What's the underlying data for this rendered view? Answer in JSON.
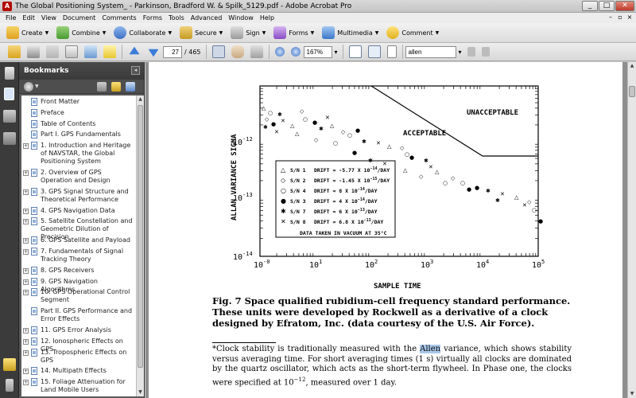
{
  "window": {
    "title": "The Global Positioning System_ - Parkinson, Bradford W. & Spilk_5129.pdf - Adobe Acrobat Pro",
    "controls": [
      "_",
      "□",
      "✕"
    ]
  },
  "menubar": {
    "items": [
      "File",
      "Edit",
      "View",
      "Document",
      "Comments",
      "Forms",
      "Tools",
      "Advanced",
      "Window",
      "Help"
    ]
  },
  "toolbar1": {
    "create": "Create",
    "combine": "Combine",
    "collaborate": "Collaborate",
    "secure": "Secure",
    "sign": "Sign",
    "forms": "Forms",
    "multimedia": "Multimedia",
    "comment": "Comment"
  },
  "toolbar2": {
    "page_current": "27",
    "page_total": "/ 465",
    "zoom": "167%",
    "search_value": "allen"
  },
  "bookmarks": {
    "title": "Bookmarks",
    "items": [
      {
        "label": "Front Matter",
        "expandable": false
      },
      {
        "label": "Preface",
        "expandable": false
      },
      {
        "label": "Table of Contents",
        "expandable": false
      },
      {
        "label": "Part I. GPS Fundamentals",
        "expandable": false
      },
      {
        "label": "1. Introduction and Heritage of NAVSTAR, the Global Positioning System",
        "expandable": true
      },
      {
        "label": "2. Overview of GPS Operation and Design",
        "expandable": true
      },
      {
        "label": "3. GPS Signal Structure and Theoretical Performance",
        "expandable": true
      },
      {
        "label": "4. GPS Navigation Data",
        "expandable": true
      },
      {
        "label": "5. Satellite Constellation and Geometric Dilution of Precision",
        "expandable": true
      },
      {
        "label": "6. GPS Satellite and Payload",
        "expandable": true
      },
      {
        "label": "7. Fundamentals of Signal Tracking Theory",
        "expandable": true
      },
      {
        "label": "8. GPS Receivers",
        "expandable": true
      },
      {
        "label": "9. GPS Navigation Algorithms",
        "expandable": true
      },
      {
        "label": "10. GPS Operational Control Segment",
        "expandable": true
      },
      {
        "label": "Part II. GPS Performance and Error Effects",
        "expandable": false
      },
      {
        "label": "11. GPS Error Analysis",
        "expandable": true
      },
      {
        "label": "12. Ionospheric Effects on GPS",
        "expandable": true
      },
      {
        "label": "13. Tropospheric Effects on GPS",
        "expandable": true
      },
      {
        "label": "14. Multipath Effects",
        "expandable": true
      },
      {
        "label": "15. Foliage Attenuation for Land Mobile Users",
        "expandable": true
      }
    ]
  },
  "figure": {
    "ylabel": "ALLAN VARIANCE SIGMA",
    "xlabel": "SAMPLE TIME",
    "unacceptable": "UNACCEPTABLE",
    "acceptable": "ACCEPTABLE",
    "x_ticks": [
      {
        "base": "10",
        "exp": "-0"
      },
      {
        "base": "10",
        "exp": "1"
      },
      {
        "base": "10",
        "exp": "2"
      },
      {
        "base": "10",
        "exp": "3"
      },
      {
        "base": "10",
        "exp": "4"
      },
      {
        "base": "10",
        "exp": "5"
      }
    ],
    "y_ticks": [
      {
        "base": "10",
        "exp": "-12"
      },
      {
        "base": "10",
        "exp": "-13"
      },
      {
        "base": "10",
        "exp": "-14"
      }
    ],
    "legend": [
      {
        "sym": "△",
        "sn": "S/N 1",
        "drift": "DRIFT = -5.77 X 10",
        "exp": "-14",
        "unit": "/DAY"
      },
      {
        "sym": "◇",
        "sn": "S/N 2",
        "drift": "DRIFT = -1.45 X 10",
        "exp": "-15",
        "unit": "/DAY"
      },
      {
        "sym": "○",
        "sn": "S/N 4",
        "drift": "DRIFT = 8 X 10",
        "exp": "-14",
        "unit": "/DAY"
      },
      {
        "sym": "●",
        "sn": "S/N 3",
        "drift": "DRIFT = 4 X 10",
        "exp": "-14",
        "unit": "/DAY"
      },
      {
        "sym": "✱",
        "sn": "S/N 7",
        "drift": "DRIFT = 6 X 10",
        "exp": "-13",
        "unit": "/DAY"
      },
      {
        "sym": "✕",
        "sn": "S/N 8",
        "drift": "DRIFT = 6.8 X 10",
        "exp": "-13",
        "unit": "/DAY"
      }
    ],
    "legend_note": "DATA TAKEN IN VACUUM AT 35°C"
  },
  "caption": {
    "text": "Fig. 7   Space qualified rubidium-cell frequency standard performance. These units were developed by Rockwell as a derivative of a clock designed by Efratom, Inc. (data courtesy of the U.S. Air Force)."
  },
  "footnote": {
    "part1": "*Clock stability is traditionally measured with the ",
    "highlight": "Allen",
    "part2": " variance, which shows stability versus averaging time. For short averaging times (1 s) virtually all clocks are dominated by the quartz oscillator, which acts as the short-term flywheel. In Phase one, the clocks were specified at 10",
    "exp": "−12",
    "part3": ", measured over 1 day."
  },
  "colors": {
    "acrobat_red": "#b30b00",
    "panel_dark": "#3b3b3b",
    "doc_bg": "#8e8e8e",
    "highlight": "#a9c8ea"
  }
}
